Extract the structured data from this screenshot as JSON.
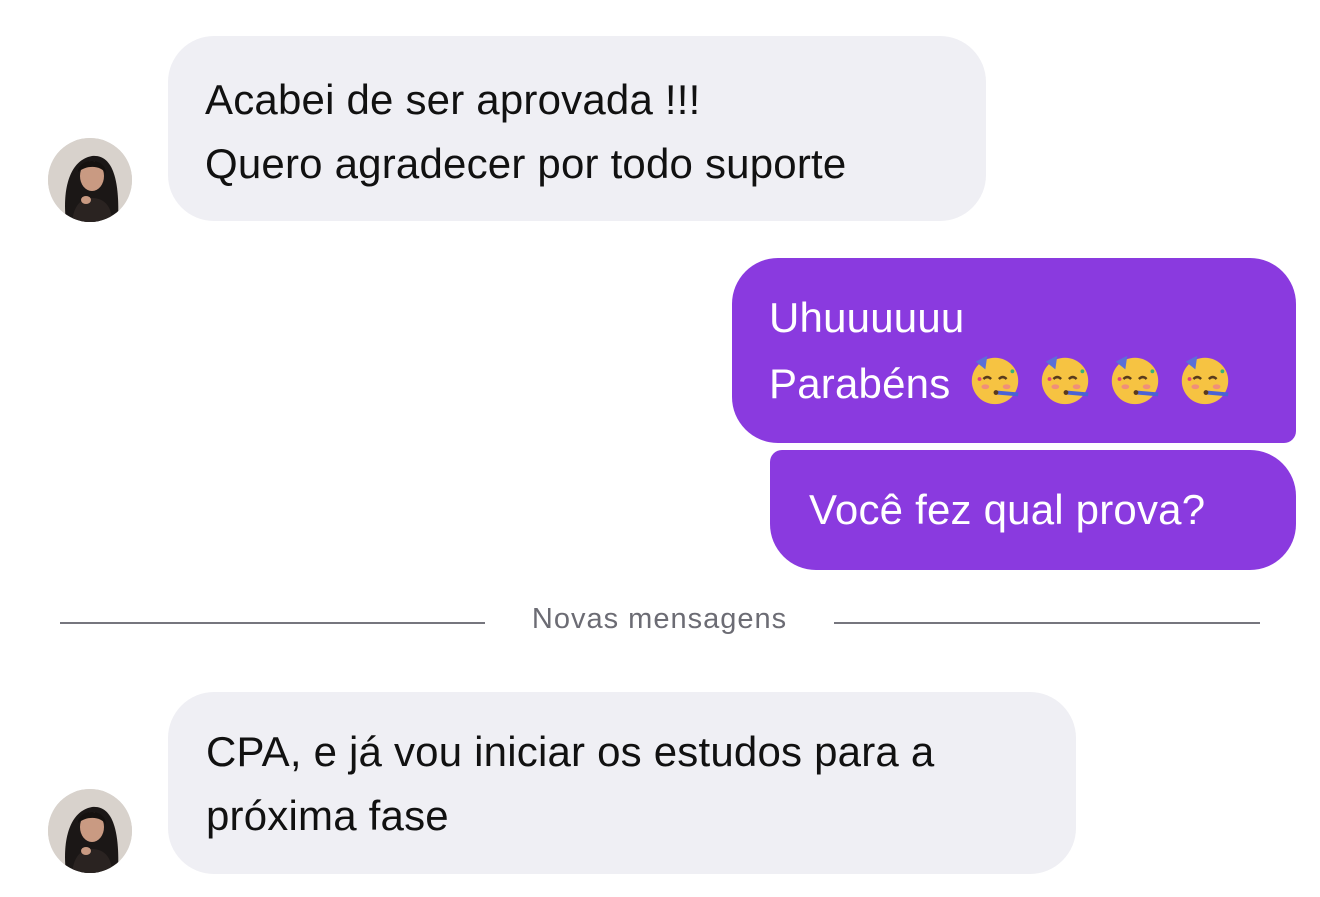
{
  "conversation": {
    "messages": [
      {
        "direction": "incoming",
        "lines": [
          "Acabei de ser aprovada !!!",
          "Quero agradecer por todo suporte"
        ]
      },
      {
        "direction": "outgoing",
        "lines": [
          "Uhuuuuuu",
          "Parabéns"
        ],
        "emoji": "partying-face",
        "emoji_count": 4
      },
      {
        "direction": "outgoing",
        "lines": [
          "Você fez qual prova?"
        ]
      },
      {
        "direction": "incoming",
        "lines": [
          "CPA, e já vou iniciar os estudos para a",
          "próxima fase"
        ]
      }
    ],
    "new_messages_divider": "Novas mensagens"
  },
  "colors": {
    "incoming_bubble": "#efeff4",
    "outgoing_bubble": "#8a3adf",
    "divider_line": "#76767e",
    "divider_text": "#6c6c74"
  },
  "icons": {
    "avatar": "user-avatar-photo",
    "emoji": "partying-face-emoji"
  }
}
